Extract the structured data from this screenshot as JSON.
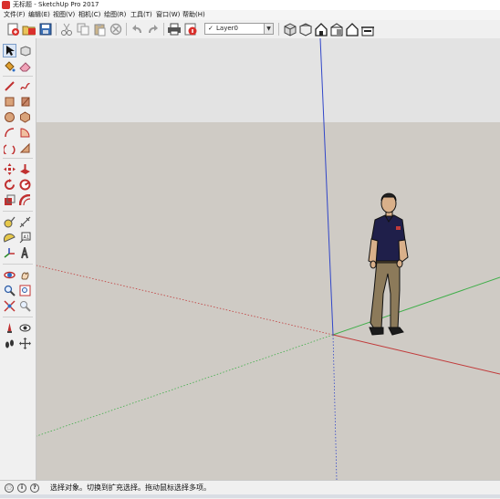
{
  "window": {
    "title": "无标题 - SketchUp Pro 2017"
  },
  "menu": {
    "items": [
      {
        "label": "文件(F)"
      },
      {
        "label": "编辑(E)"
      },
      {
        "label": "视图(V)"
      },
      {
        "label": "相机(C)"
      },
      {
        "label": "绘图(R)"
      },
      {
        "label": "工具(T)"
      },
      {
        "label": "窗口(W)"
      },
      {
        "label": "帮助(H)"
      }
    ]
  },
  "toolbar": {
    "layer": {
      "check": "✓",
      "value": "Layer0"
    }
  },
  "status": {
    "message": "选择对象。切换到扩充选择。拖动鼠标选择多项。"
  },
  "colors": {
    "sky": "#e3e3e3",
    "ground": "#cfcbc5",
    "axis_red": "#c13a3a",
    "axis_green": "#3fae49",
    "axis_blue": "#3146c8",
    "shirt": "#1f1f4a",
    "pants": "#8c7a5a"
  },
  "icons": [
    "app-logo-icon",
    "new-icon",
    "open-icon",
    "save-icon",
    "cut-icon",
    "copy-icon",
    "paste-icon",
    "erase-icon",
    "undo-icon",
    "redo-icon",
    "print-icon",
    "model-info-icon",
    "views-iso-icon",
    "views-top-icon",
    "views-front-icon",
    "views-right-icon",
    "views-back-icon",
    "views-left-icon",
    "select-icon",
    "component-icon",
    "paint-bucket-icon",
    "eraser-icon",
    "line-icon",
    "freehand-icon",
    "rectangle-icon",
    "rotated-rect-icon",
    "circle-icon",
    "polygon-icon",
    "arc-icon",
    "pie-icon",
    "two-point-arc-icon",
    "three-point-arc-icon",
    "move-icon",
    "push-pull-icon",
    "rotate-icon",
    "follow-me-icon",
    "scale-icon",
    "offset-icon",
    "tape-measure-icon",
    "dimension-icon",
    "protractor-icon",
    "text-icon",
    "axes-icon",
    "3d-text-icon",
    "orbit-icon",
    "pan-icon",
    "zoom-icon",
    "zoom-window-icon",
    "zoom-extents-icon",
    "previous-view-icon",
    "position-camera-icon",
    "look-around-icon",
    "walk-icon",
    "section-plane-icon"
  ]
}
